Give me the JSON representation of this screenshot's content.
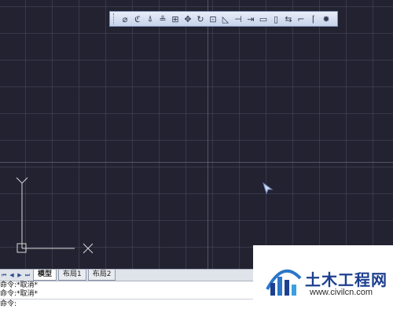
{
  "toolbar": {
    "tools": [
      {
        "icon": "erase-icon",
        "glyph": "⌀"
      },
      {
        "icon": "copy-icon",
        "glyph": "ℭ"
      },
      {
        "icon": "mirror-icon",
        "glyph": "⍋"
      },
      {
        "icon": "offset-icon",
        "glyph": "≗"
      },
      {
        "icon": "array-icon",
        "glyph": "⊞"
      },
      {
        "icon": "move-icon",
        "glyph": "✥"
      },
      {
        "icon": "rotate-icon",
        "glyph": "↻"
      },
      {
        "icon": "scale-icon",
        "glyph": "⊡"
      },
      {
        "icon": "stretch-icon",
        "glyph": "◺"
      },
      {
        "icon": "trim-icon",
        "glyph": "⊣"
      },
      {
        "icon": "extend-icon",
        "glyph": "⇥"
      },
      {
        "icon": "break-at-point-icon",
        "glyph": "▭"
      },
      {
        "icon": "break-icon",
        "glyph": "▯"
      },
      {
        "icon": "join-icon",
        "glyph": "⇆"
      },
      {
        "icon": "chamfer-icon",
        "glyph": "⌐"
      },
      {
        "icon": "fillet-icon",
        "glyph": "⌈"
      },
      {
        "icon": "explode-icon",
        "glyph": "✸"
      }
    ]
  },
  "ucs": {
    "y_label": "Y",
    "x_label": "X"
  },
  "tabs": {
    "nav": [
      "⏮",
      "◀",
      "▶",
      "⏭"
    ],
    "items": [
      {
        "label": "模型",
        "active": true
      },
      {
        "label": "布局1",
        "active": false
      },
      {
        "label": "布局2",
        "active": false
      }
    ]
  },
  "command": {
    "history": [
      "命令:*取消*",
      "命令:*取消*"
    ],
    "prompt": "命令:"
  },
  "watermark": {
    "brand": "土木工程网",
    "url": "www.civilcn.com"
  },
  "colors": {
    "viewport_bg": "#222231",
    "grid": "#4b4b5f",
    "toolbar_bg": "#d6dff0",
    "brand": "#1d3f8f"
  }
}
